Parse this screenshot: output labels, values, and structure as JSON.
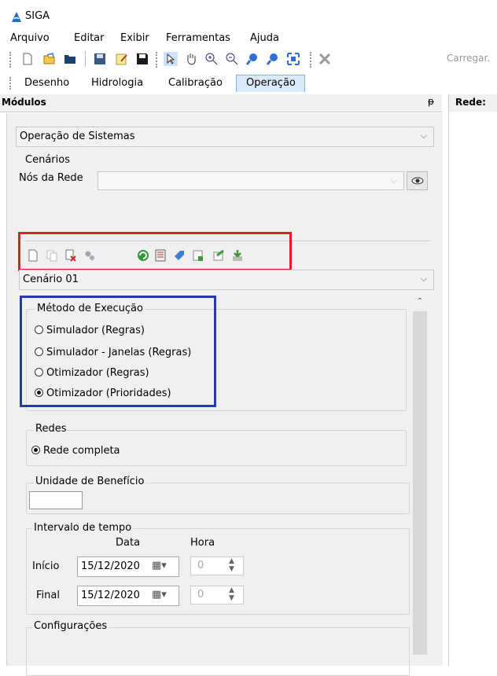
{
  "app": {
    "title": "SIGA"
  },
  "menu": [
    "Arquivo",
    "Editar",
    "Exibir",
    "Ferramentas",
    "Ajuda"
  ],
  "toolbar": {
    "carregar_label": "Carregar."
  },
  "tabs": [
    "Desenho",
    "Hidrologia",
    "Calibração",
    "Operação"
  ],
  "modules": {
    "header": "Módulos",
    "pin": "ᵽ"
  },
  "rede": {
    "header": "Rede:"
  },
  "module_select": {
    "value": "Operação de Sistemas"
  },
  "cenarios": {
    "label": "Cenários",
    "nos_label": "Nós da Rede",
    "nos_value": ""
  },
  "scenario_select": {
    "value": "Cenário 01"
  },
  "metodo": {
    "label": "Método de Execução",
    "options": [
      {
        "label": "Simulador (Regras)",
        "checked": false
      },
      {
        "label": "Simulador - Janelas (Regras)",
        "checked": false
      },
      {
        "label": "Otimizador (Regras)",
        "checked": false
      },
      {
        "label": "Otimizador (Prioridades)",
        "checked": true
      }
    ]
  },
  "redes": {
    "label": "Redes",
    "option": "Rede completa"
  },
  "unidade": {
    "label": "Unidade de Benefício",
    "value": ""
  },
  "intervalo": {
    "label": "Intervalo de tempo",
    "data_header": "Data",
    "hora_header": "Hora",
    "inicio_label": "Início",
    "inicio_date": "15/12/2020",
    "inicio_hora": "0",
    "final_label": "Final",
    "final_date": "15/12/2020",
    "final_hora": "0"
  },
  "configuracoes": {
    "label": "Configurações"
  },
  "colors": {
    "red_box": "#e6192b",
    "blue_box": "#2b35b5",
    "active_tab": "#dcebfa"
  }
}
